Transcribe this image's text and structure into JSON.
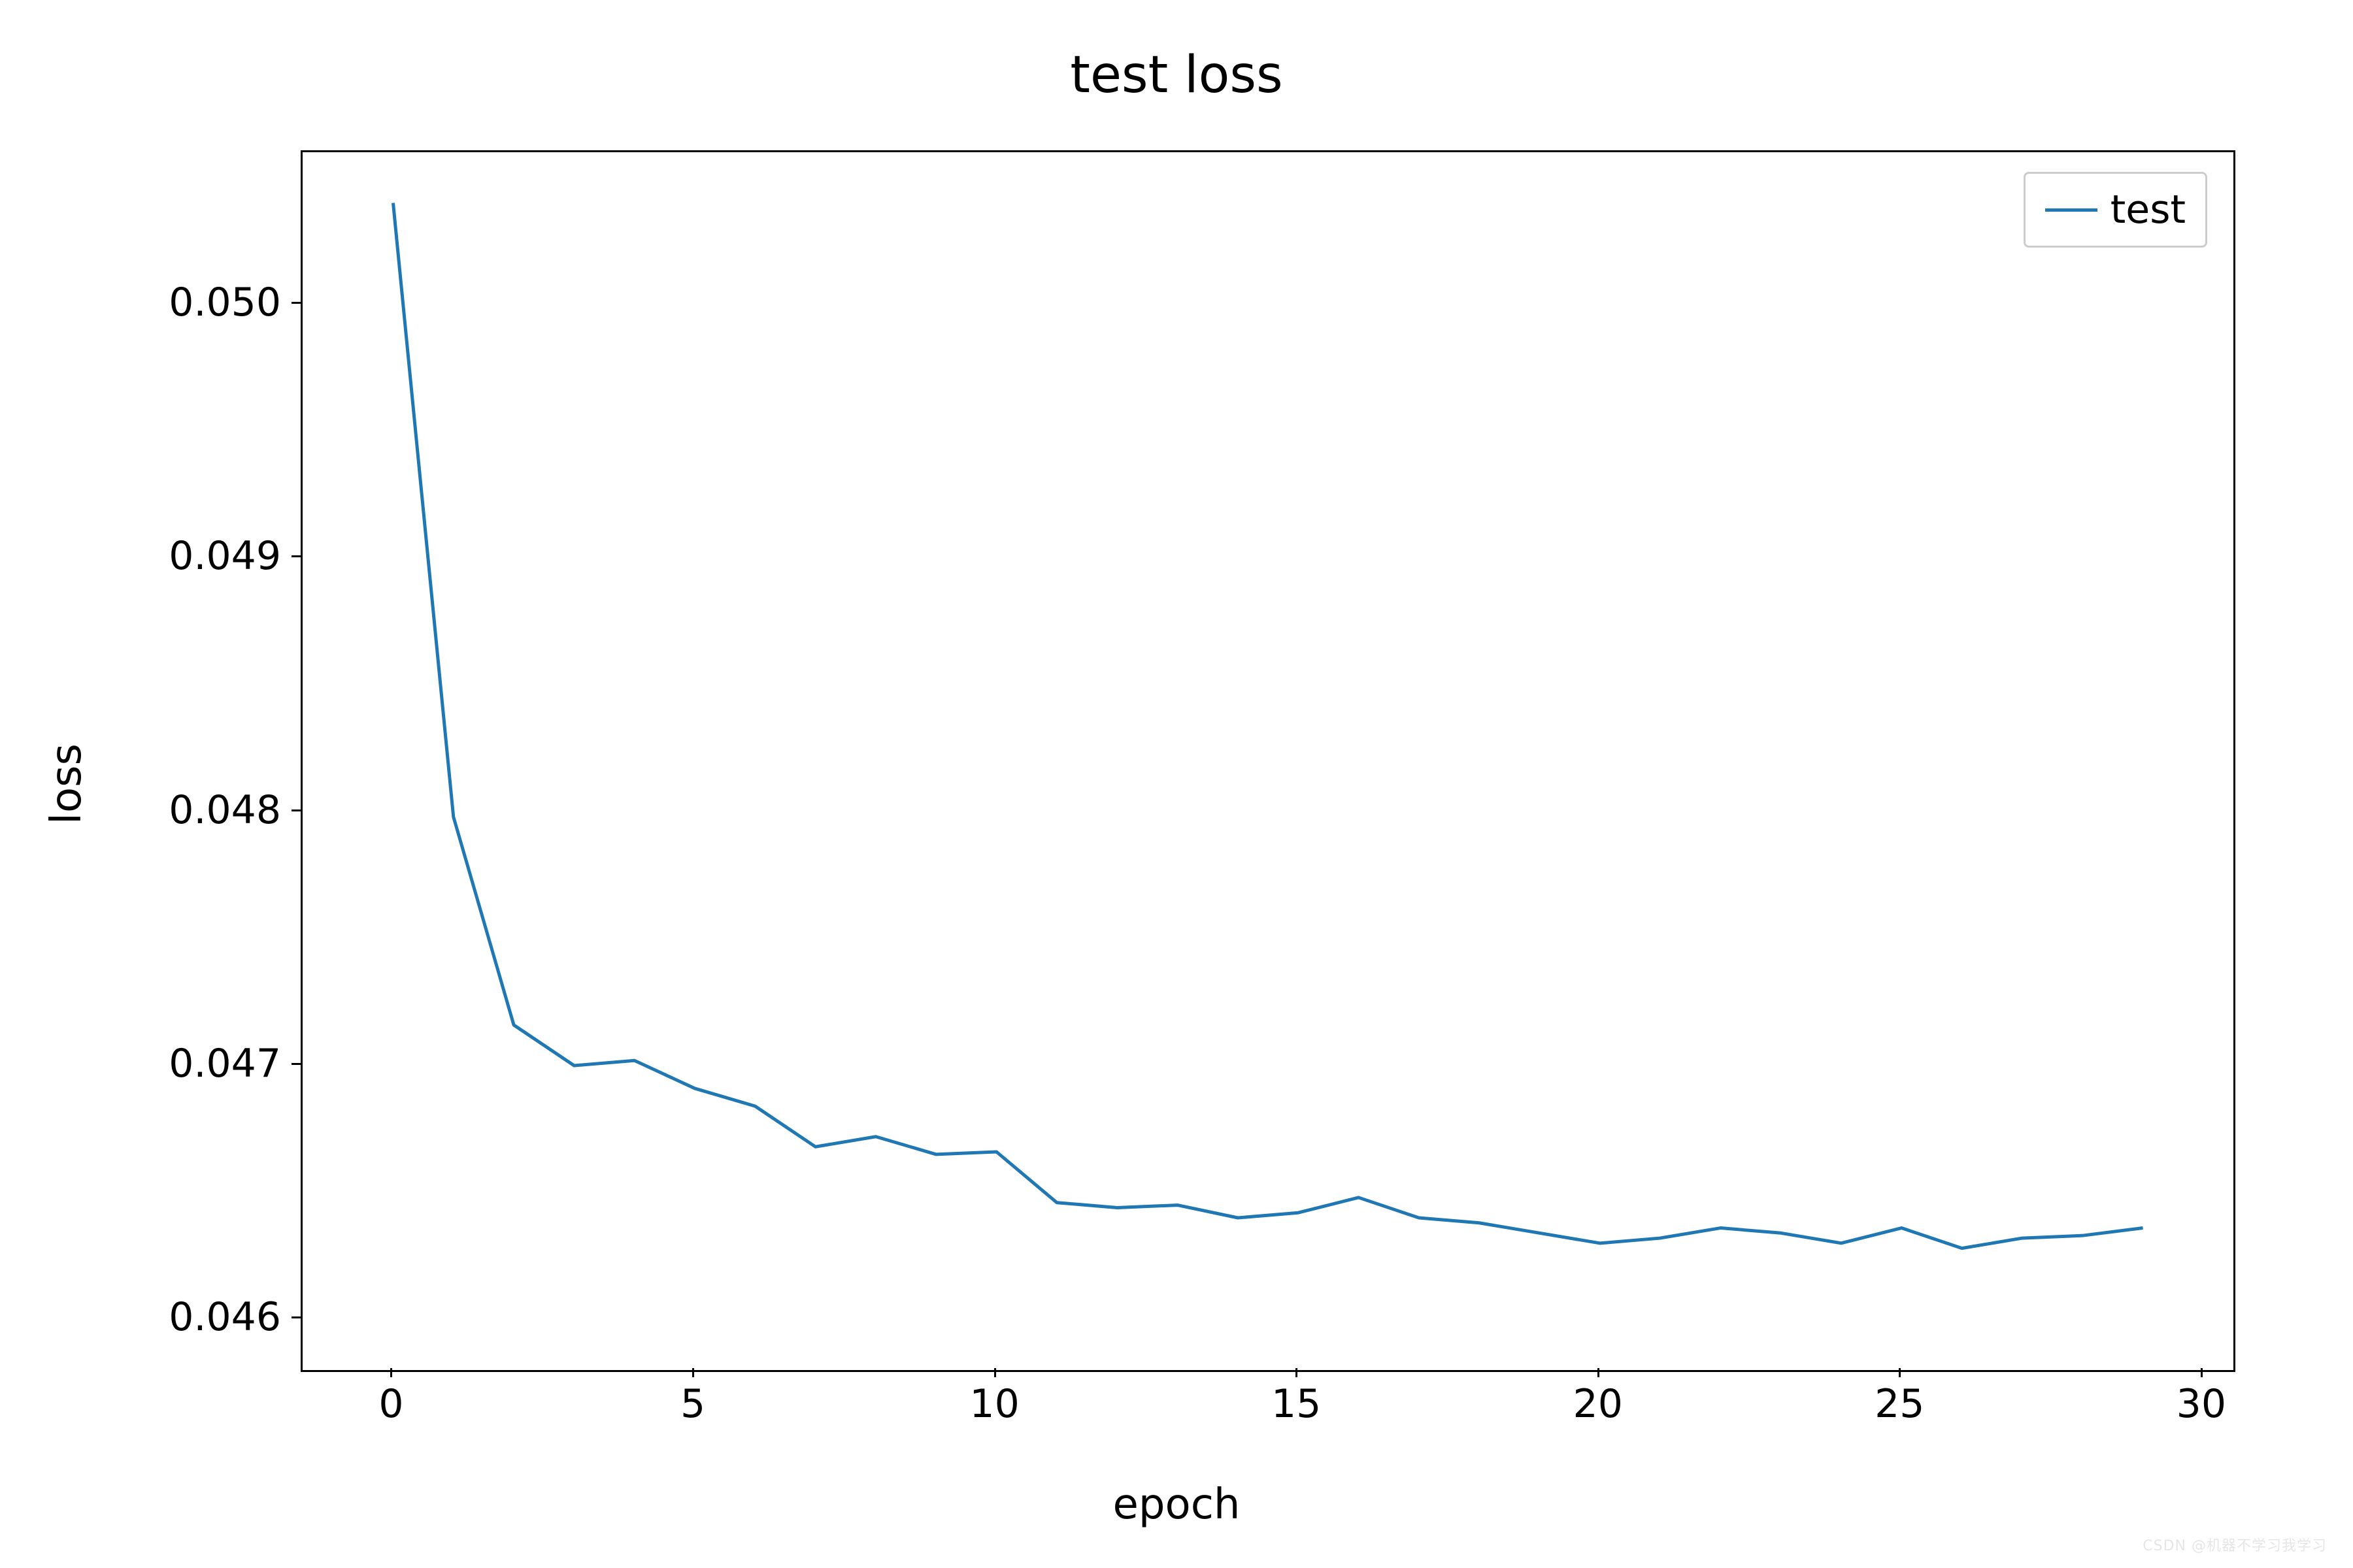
{
  "chart_data": {
    "type": "line",
    "title": "test loss",
    "xlabel": "epoch",
    "ylabel": "loss",
    "xlim": [
      -1.5,
      30.5
    ],
    "ylim": [
      0.0458,
      0.0506
    ],
    "xticks": [
      0,
      5,
      10,
      15,
      20,
      25,
      30
    ],
    "yticks": [
      0.046,
      0.047,
      0.048,
      0.049,
      0.05
    ],
    "grid": false,
    "legend_position": "upper right",
    "series": [
      {
        "name": "test",
        "color": "#1f77b4",
        "x": [
          0,
          1,
          2,
          3,
          4,
          5,
          6,
          7,
          8,
          9,
          10,
          11,
          12,
          13,
          14,
          15,
          16,
          17,
          18,
          19,
          20,
          21,
          22,
          23,
          24,
          25,
          26,
          27,
          28,
          29
        ],
        "y": [
          0.0504,
          0.04798,
          0.04716,
          0.047,
          0.04702,
          0.04691,
          0.04684,
          0.04668,
          0.04672,
          0.04665,
          0.04666,
          0.04646,
          0.04644,
          0.04645,
          0.0464,
          0.04642,
          0.04648,
          0.0464,
          0.04638,
          0.04634,
          0.0463,
          0.04632,
          0.04636,
          0.04634,
          0.0463,
          0.04636,
          0.04628,
          0.04632,
          0.04633,
          0.04636
        ]
      }
    ]
  },
  "watermark": "CSDN @机器不学习我学习"
}
